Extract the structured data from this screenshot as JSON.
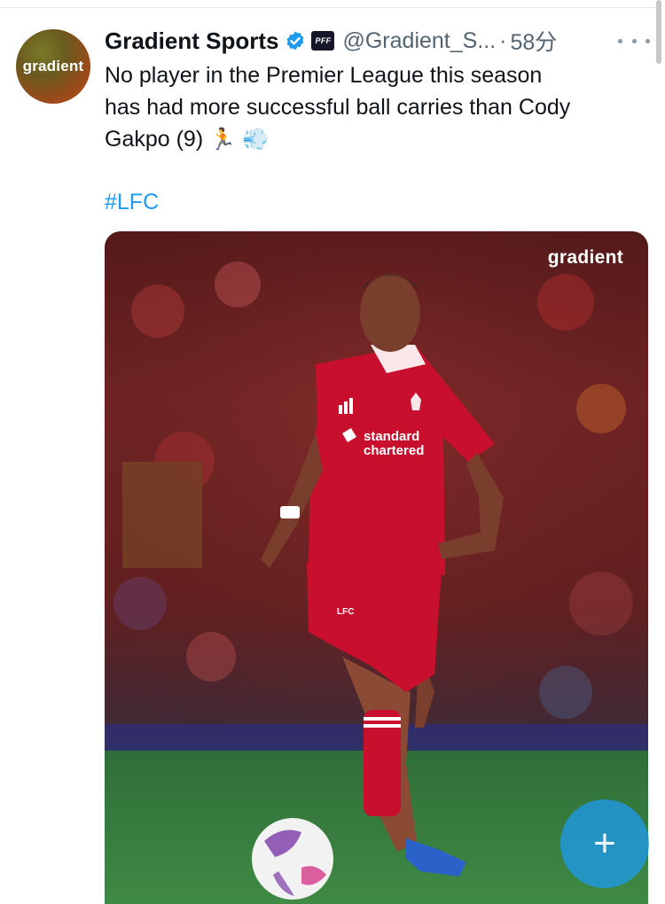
{
  "tweet": {
    "display_name": "Gradient Sports",
    "handle": "@Gradient_S...",
    "separator": "·",
    "time": "58分",
    "text_line1": "No player in the Premier League this season",
    "text_line2": "has had more successful ball carries than Cody",
    "text_line3": "Gakpo (9)",
    "emoji_runner": "🏃",
    "emoji_dash": "💨",
    "hashtag": "#LFC"
  },
  "avatar": {
    "text": "gradient"
  },
  "badge": {
    "text": "PFF"
  },
  "media": {
    "watermark": "gradient",
    "sponsor_line1": "standard",
    "sponsor_line2": "chartered",
    "shorts_label": "LFC"
  },
  "fab": {
    "symbol": "+"
  },
  "colors": {
    "link": "#1d9bf0",
    "verified": "#1d9bf0",
    "jersey": "#c8102e",
    "secondary_text": "#536471"
  },
  "icons": {
    "verified": "verified-badge-icon",
    "more": "more-horizontal-icon",
    "compose": "plus-icon"
  }
}
